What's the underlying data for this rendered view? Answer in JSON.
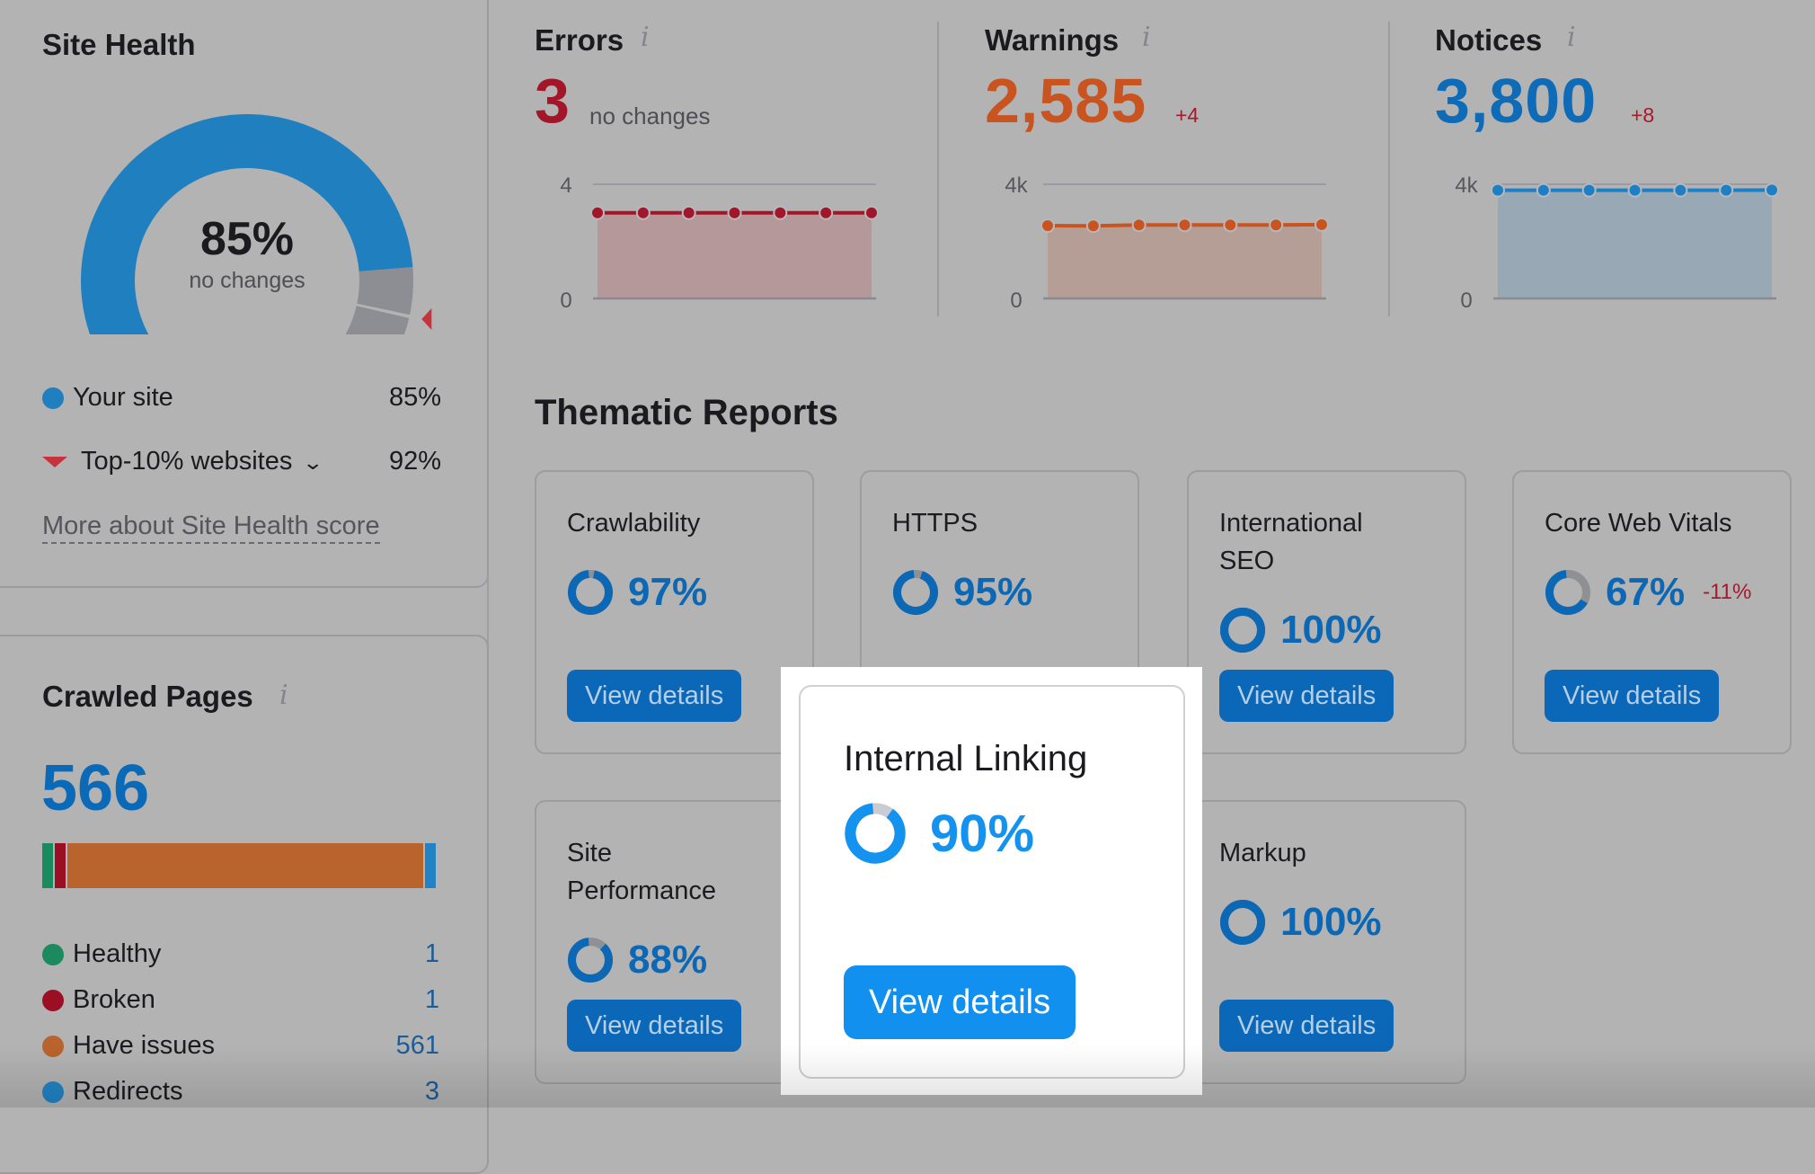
{
  "site_health": {
    "title": "Site Health",
    "score": "85%",
    "score_value": 85,
    "change_text": "no changes",
    "top10_value": 92,
    "legend": [
      {
        "label": "Your site",
        "value": "85%",
        "color": "#1f7fbf",
        "marker": "dot"
      },
      {
        "label": "Top-10% websites",
        "value": "92%",
        "color": "#c7323c",
        "marker": "triangle",
        "has_dropdown": true
      }
    ],
    "more_link": "More about Site Health score",
    "colors": {
      "gauge_fill": "#1f7fbf",
      "gauge_rest": "#8d8e93",
      "marker": "#c7323c"
    }
  },
  "crawled_pages": {
    "title": "Crawled Pages",
    "total": "566",
    "segments": [
      {
        "label": "Healthy",
        "value": 1,
        "display": "1",
        "color": "#1b8a5e"
      },
      {
        "label": "Broken",
        "value": 1,
        "display": "1",
        "color": "#9b0f25"
      },
      {
        "label": "Have issues",
        "value": 561,
        "display": "561",
        "color": "#b9632d"
      },
      {
        "label": "Redirects",
        "value": 3,
        "display": "3",
        "color": "#2282c4"
      }
    ]
  },
  "metrics": [
    {
      "title": "Errors",
      "value": "3",
      "delta": "no changes",
      "delta_neutral": true,
      "color": "#a3162a",
      "chart": {
        "ymax_label": "4",
        "ymin_label": "0",
        "ymax": 4,
        "points": [
          3,
          3,
          3,
          3,
          3,
          3,
          3
        ],
        "fill": "#b4989a"
      }
    },
    {
      "title": "Warnings",
      "value": "2,585",
      "delta": "+4",
      "delta_neutral": false,
      "color": "#c9541f",
      "chart": {
        "ymax_label": "4k",
        "ymin_label": "0",
        "ymax": 4000,
        "points": [
          2550,
          2545,
          2575,
          2575,
          2575,
          2575,
          2585
        ],
        "fill": "#b49e96"
      }
    },
    {
      "title": "Notices",
      "value": "3,800",
      "delta": "+8",
      "delta_neutral": false,
      "color": "#0d6bb8",
      "chart": {
        "ymax_label": "4k",
        "ymin_label": "0",
        "ymax": 4000,
        "points": [
          3790,
          3790,
          3790,
          3790,
          3792,
          3792,
          3800
        ],
        "fill": "#98a8b4",
        "line_color": "#1d7fc4"
      }
    }
  ],
  "thematic": {
    "title": "Thematic Reports",
    "button_label": "View details",
    "cards": [
      {
        "title": "Crawlability",
        "score": "97%",
        "value": 97
      },
      {
        "title": "HTTPS",
        "score": "95%",
        "value": 95
      },
      {
        "title": "International SEO",
        "score": "100%",
        "value": 100
      },
      {
        "title": "Core Web Vitals",
        "score": "67%",
        "value": 67,
        "delta": "-11%"
      },
      {
        "title": "Site Performance",
        "score": "88%",
        "value": 88
      },
      {
        "title": "Internal Linking",
        "score": "90%",
        "value": 90,
        "highlighted": true
      },
      {
        "title": "Markup",
        "score": "100%",
        "value": 100
      }
    ]
  }
}
